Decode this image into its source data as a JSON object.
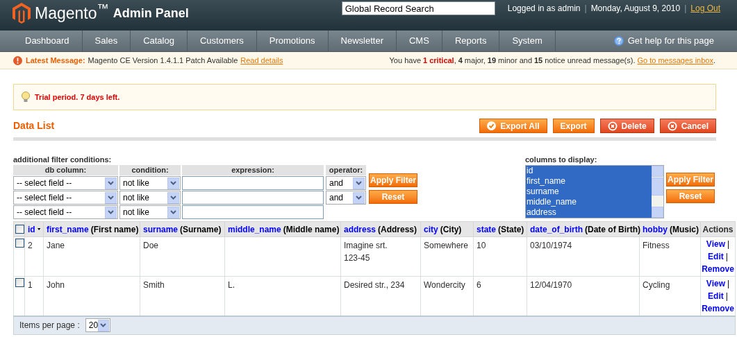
{
  "header": {
    "brand": "Magento$^{™}$",
    "subtitle": "Admin Panel",
    "search": {
      "value": "Global Record Search"
    },
    "user": "Logged in as admin",
    "separators": [
      "|",
      "|"
    ],
    "date": "Monday, August 9, 2010",
    "logout": "Log Out"
  },
  "nav": {
    "items": [
      {
        "label": "Dashboard",
        "selected": false
      },
      {
        "label": "Sales",
        "selected": false
      },
      {
        "label": "Catalog",
        "selected": false
      },
      {
        "label": "Customers",
        "selected": false
      },
      {
        "label": "Promotions",
        "selected": false
      },
      {
        "label": "Newsletter",
        "selected": false
      },
      {
        "label": "CMS",
        "selected": false
      },
      {
        "label": "Reports",
        "selected": false
      },
      {
        "label": "System",
        "selected": false
      }
    ],
    "help": "Get help for this page"
  },
  "message": {
    "title": "Latest Message:",
    "text": "Magento CE Version 1.4.1.1 Patch Available",
    "link": "Read details",
    "summary": [
      {
        "kind": "plain",
        "text": "You have"
      },
      {
        "kind": "critical",
        "text": "1 critical"
      },
      {
        "kind": "plain",
        "text": ","
      },
      {
        "kind": "bold",
        "text": "4"
      },
      {
        "kind": "plain",
        "text": "major,"
      },
      {
        "kind": "bold",
        "text": "19"
      },
      {
        "kind": "plain",
        "text": "minor and"
      },
      {
        "kind": "bold",
        "text": "15"
      },
      {
        "kind": "plain",
        "text": "notice unread message(s)."
      }
    ],
    "inbox_link": "Go to messages inbox",
    "end": "."
  },
  "notice": "Trial period. 7 days left.",
  "page": {
    "title": "Data List",
    "buttons": [
      {
        "label": "Export All",
        "kind": "check"
      },
      {
        "label": "Export",
        "kind": "plain"
      },
      {
        "label": "Delete",
        "kind": "delete"
      },
      {
        "label": "Cancel",
        "kind": "delete"
      }
    ]
  },
  "filter": {
    "title": "additional filter conditions:",
    "headings": [
      "db column:",
      "condition:",
      "expression:",
      "operator:"
    ],
    "rows": [
      {
        "field": "-- select field --",
        "condition": "not like",
        "operator": "and"
      },
      {
        "field": "-- select field --",
        "condition": "not like",
        "operator": "and"
      },
      {
        "field": "-- select field --",
        "condition": "not like"
      }
    ],
    "buttons": [
      "Apply Filter",
      "Reset"
    ]
  },
  "columns_to_display": {
    "title": "columns to display:",
    "items": [
      {
        "label": "id",
        "selected": true
      },
      {
        "label": "first_name",
        "selected": true
      },
      {
        "label": "surname",
        "selected": true
      },
      {
        "label": "middle_name",
        "selected": true
      },
      {
        "label": "address",
        "selected": true
      }
    ],
    "buttons": [
      "Apply Filter",
      "Reset"
    ]
  },
  "table": {
    "select_all_checked": false,
    "columns": [
      {
        "field": "id",
        "sorted": true
      },
      {
        "field": "first_name",
        "label": "(First name)",
        "sorted": false
      },
      {
        "field": "surname",
        "label": "(Surname)",
        "sorted": false
      },
      {
        "field": "middle_name",
        "label": "(Middle name)",
        "sorted": false
      },
      {
        "field": "address",
        "label": "(Address)",
        "sorted": false
      },
      {
        "field": "city",
        "label": "(City)",
        "sorted": false
      },
      {
        "field": "state",
        "label": "(State)",
        "sorted": false
      },
      {
        "field": "date_of_birth",
        "label": "(Date of Birth)",
        "sorted": false
      },
      {
        "field": "hobby",
        "label": "(Music)",
        "sorted": false
      }
    ],
    "actions_heading": "Actions",
    "rows": [
      {
        "checked": false,
        "cells": [
          "2",
          "Jane",
          "Doe",
          "",
          "Imagine srt. 123-45",
          "Somewhere",
          "10",
          "03/10/1974",
          "Fitness"
        ],
        "actions": [
          {
            "label": "View",
            "separator": "|"
          },
          {
            "label": "Edit",
            "separator": "|"
          },
          {
            "label": "Remove"
          }
        ]
      },
      {
        "checked": false,
        "cells": [
          "1",
          "John",
          "Smith",
          "L.",
          "Desired str., 234",
          "Wondercity",
          "6",
          "12/04/1970",
          "Cycling"
        ],
        "actions": [
          {
            "label": "View",
            "separator": "|"
          },
          {
            "label": "Edit",
            "separator": "|"
          },
          {
            "label": "Remove"
          }
        ]
      }
    ],
    "per_page_label": "Items per page :",
    "per_page": "20"
  }
}
